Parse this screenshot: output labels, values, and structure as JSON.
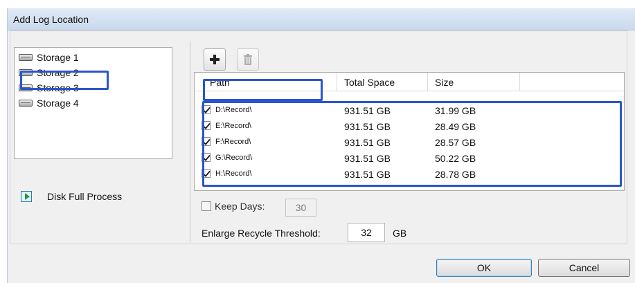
{
  "window": {
    "title": "Add Log Location"
  },
  "storage_toolbar": {
    "add_icon": "plus-icon",
    "delete_icon": "trash-icon"
  },
  "storage_list": {
    "items": [
      {
        "label": "Storage 1",
        "icon": "disk-icon",
        "selected": true
      },
      {
        "label": "Storage 2",
        "icon": "disk-icon"
      },
      {
        "label": "Storage 3",
        "icon": "disk-icon"
      },
      {
        "label": "Storage 4",
        "icon": "disk-icon"
      }
    ]
  },
  "disk_full": {
    "label": "Disk Full Process",
    "icon": "play-icon"
  },
  "path_toolbar": {
    "add_icon": "plus-icon",
    "delete_icon": "trash-icon",
    "delete_disabled": true
  },
  "path_table": {
    "columns": [
      "Path",
      "Total Space",
      "Size"
    ],
    "rows": [
      {
        "checked": true,
        "path": "D:\\Record\\",
        "total": "931.51 GB",
        "size": "31.99 GB"
      },
      {
        "checked": true,
        "path": "E:\\Record\\",
        "total": "931.51 GB",
        "size": "28.49 GB"
      },
      {
        "checked": true,
        "path": "F:\\Record\\",
        "total": "931.51 GB",
        "size": "28.57 GB"
      },
      {
        "checked": true,
        "path": "G:\\Record\\",
        "total": "931.51 GB",
        "size": "50.22 GB"
      },
      {
        "checked": true,
        "path": "H:\\Record\\",
        "total": "931.51 GB",
        "size": "28.78 GB"
      }
    ]
  },
  "keep_days": {
    "label": "Keep Days:",
    "checked": false,
    "value": "30"
  },
  "enlarge": {
    "label": "Enlarge Recycle Threshold:",
    "value": "32",
    "unit": "GB"
  },
  "buttons": {
    "ok": "OK",
    "cancel": "Cancel"
  },
  "colors": {
    "highlight": "#2a55cc",
    "titlebar": "#cad9ec"
  }
}
